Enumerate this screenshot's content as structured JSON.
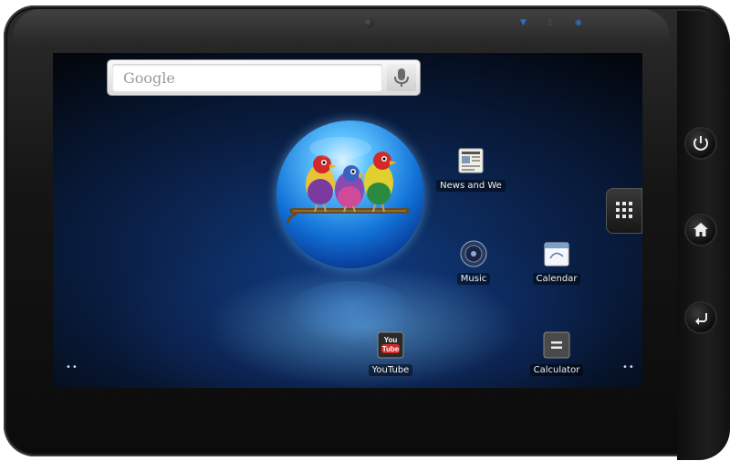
{
  "search": {
    "placeholder": "Google"
  },
  "apps": [
    {
      "label": "News and We"
    },
    {
      "label": "Music"
    },
    {
      "label": "Calendar"
    },
    {
      "label": "YouTube"
    },
    {
      "label": "Calculator"
    }
  ],
  "pager": {
    "left": "••",
    "right": "••"
  },
  "youtube_logo": {
    "you": "You",
    "tube": "Tube"
  },
  "hardware_buttons": [
    "power-icon",
    "home-icon",
    "back-icon"
  ],
  "colors": {
    "accent": "#2a6fd0",
    "screen_dark": "#030810",
    "screen_glow": "#78c8ff"
  }
}
